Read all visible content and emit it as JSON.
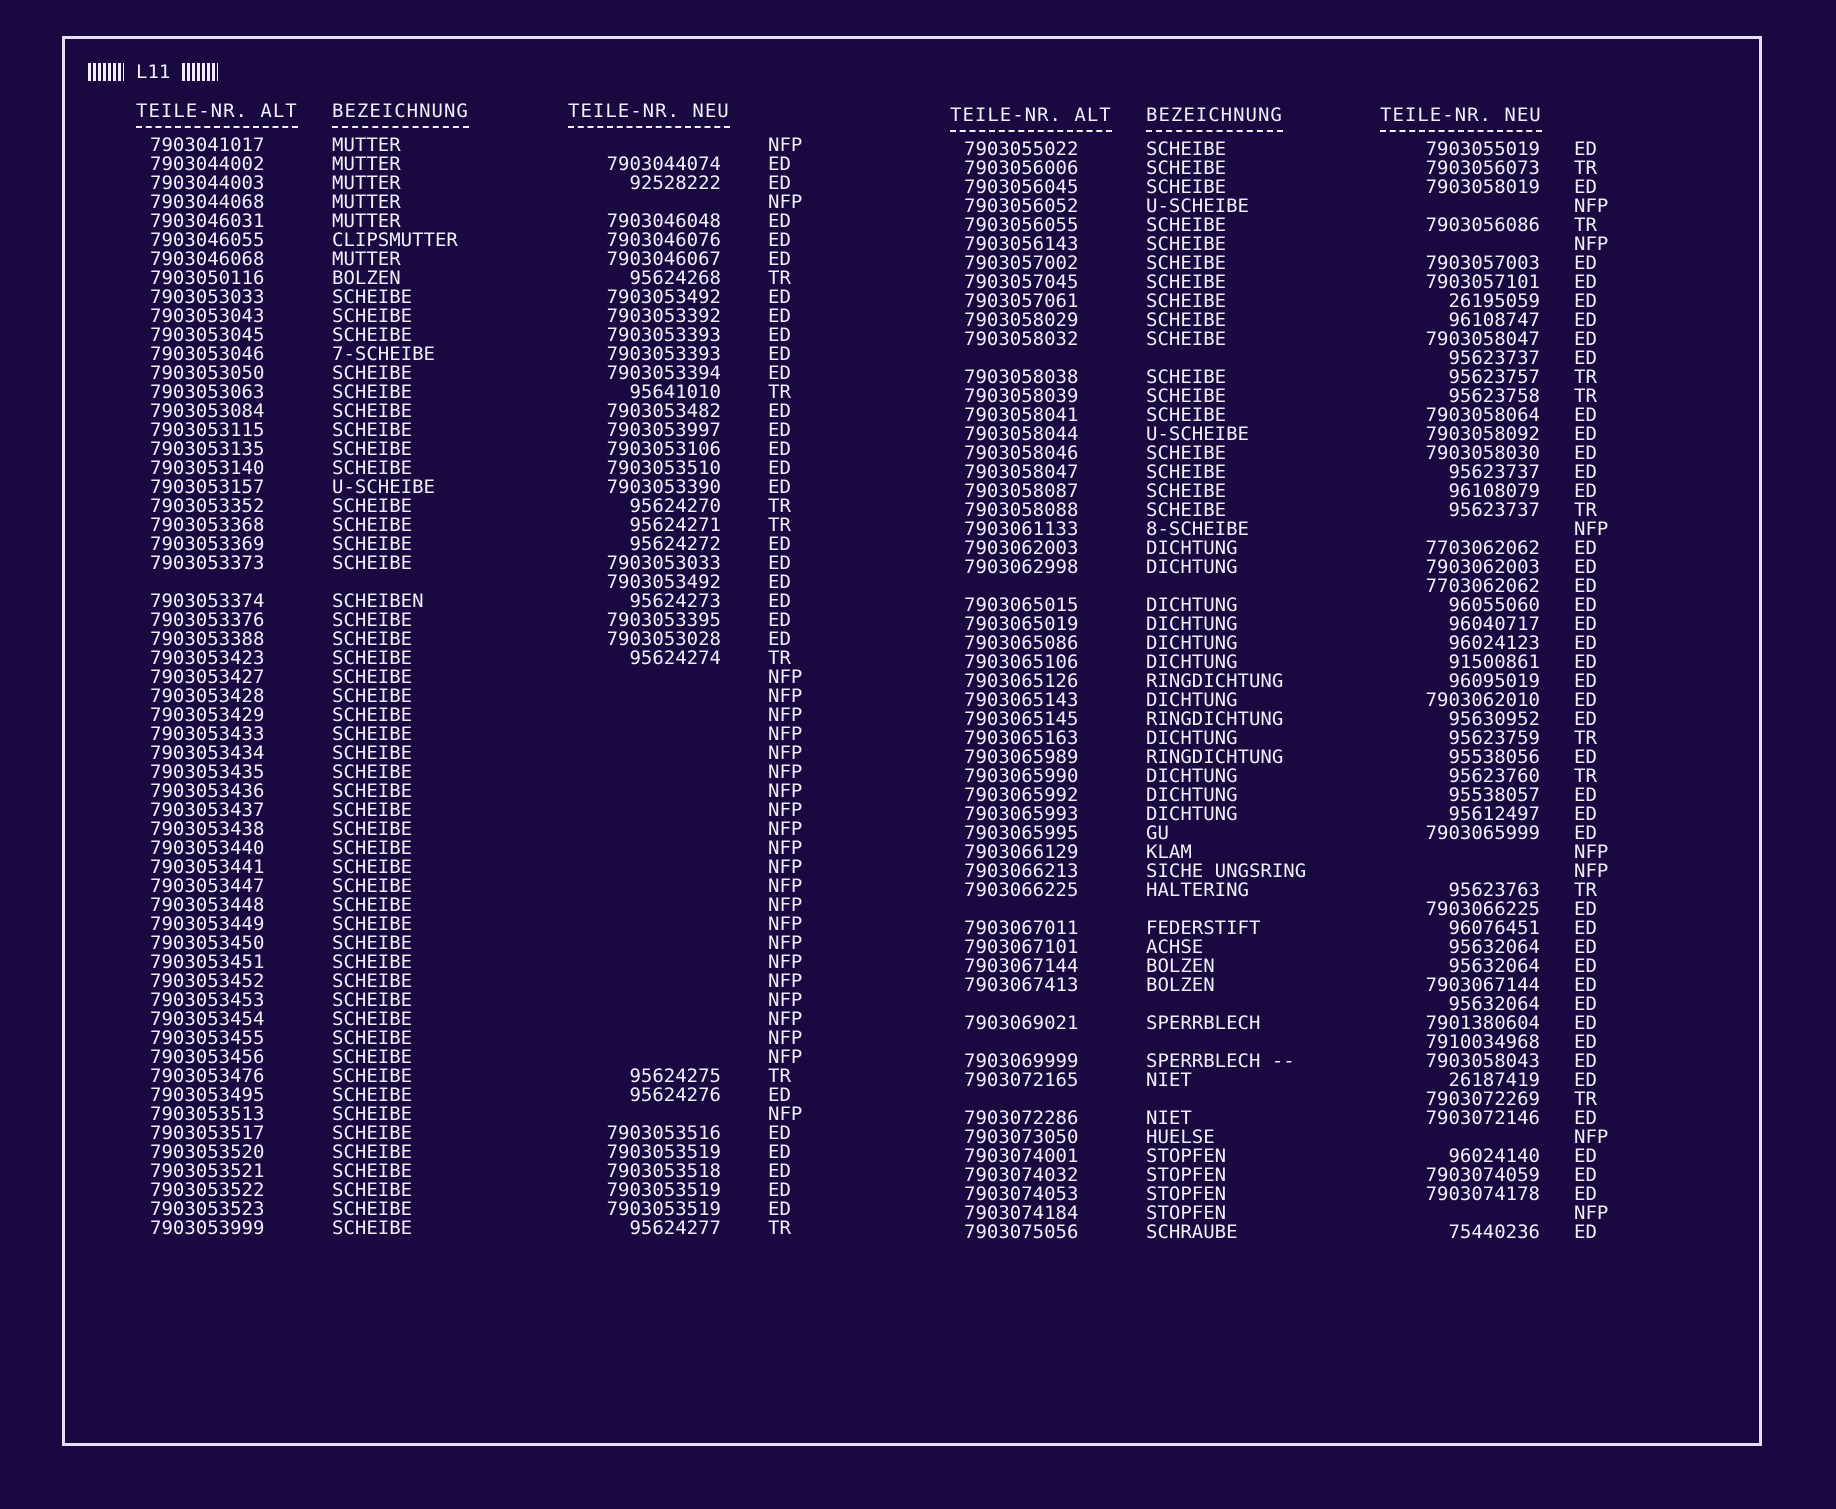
{
  "page_label": "L11",
  "headers": {
    "alt": "TEILE-NR. ALT",
    "bez": "BEZEICHNUNG",
    "neu": "TEILE-NR. NEU"
  },
  "left_rows": [
    {
      "alt": "7903041017",
      "bez": "MUTTER",
      "neu": "",
      "code": "NFP"
    },
    {
      "alt": "7903044002",
      "bez": "MUTTER",
      "neu": "7903044074",
      "code": "ED"
    },
    {
      "alt": "7903044003",
      "bez": "MUTTER",
      "neu": "92528222",
      "code": "ED"
    },
    {
      "alt": "7903044068",
      "bez": "MUTTER",
      "neu": "",
      "code": "NFP"
    },
    {
      "alt": "7903046031",
      "bez": "MUTTER",
      "neu": "7903046048",
      "code": "ED"
    },
    {
      "alt": "7903046055",
      "bez": "CLIPSMUTTER",
      "neu": "7903046076",
      "code": "ED"
    },
    {
      "alt": "7903046068",
      "bez": "MUTTER",
      "neu": "7903046067",
      "code": "ED"
    },
    {
      "alt": "7903050116",
      "bez": "BOLZEN",
      "neu": "95624268",
      "code": "TR"
    },
    {
      "alt": "7903053033",
      "bez": "SCHEIBE",
      "neu": "7903053492",
      "code": "ED"
    },
    {
      "alt": "7903053043",
      "bez": "SCHEIBE",
      "neu": "7903053392",
      "code": "ED"
    },
    {
      "alt": "7903053045",
      "bez": "SCHEIBE",
      "neu": "7903053393",
      "code": "ED"
    },
    {
      "alt": "7903053046",
      "bez": "7-SCHEIBE",
      "neu": "7903053393",
      "code": "ED"
    },
    {
      "alt": "7903053050",
      "bez": "SCHEIBE",
      "neu": "7903053394",
      "code": "ED"
    },
    {
      "alt": "7903053063",
      "bez": "SCHEIBE",
      "neu": "95641010",
      "code": "TR"
    },
    {
      "alt": "7903053084",
      "bez": "SCHEIBE",
      "neu": "7903053482",
      "code": "ED"
    },
    {
      "alt": "7903053115",
      "bez": "SCHEIBE",
      "neu": "7903053997",
      "code": "ED"
    },
    {
      "alt": "7903053135",
      "bez": "SCHEIBE",
      "neu": "7903053106",
      "code": "ED"
    },
    {
      "alt": "7903053140",
      "bez": "SCHEIBE",
      "neu": "7903053510",
      "code": "ED"
    },
    {
      "alt": "7903053157",
      "bez": "U-SCHEIBE",
      "neu": "7903053390",
      "code": "ED"
    },
    {
      "alt": "7903053352",
      "bez": "SCHEIBE",
      "neu": "95624270",
      "code": "TR"
    },
    {
      "alt": "7903053368",
      "bez": "SCHEIBE",
      "neu": "95624271",
      "code": "TR"
    },
    {
      "alt": "7903053369",
      "bez": "SCHEIBE",
      "neu": "95624272",
      "code": "ED"
    },
    {
      "alt": "7903053373",
      "bez": "SCHEIBE",
      "neu": "7903053033",
      "code": "ED"
    },
    {
      "alt": "",
      "bez": "",
      "neu": "7903053492",
      "code": "ED"
    },
    {
      "alt": "7903053374",
      "bez": "SCHEIBEN",
      "neu": "95624273",
      "code": "ED"
    },
    {
      "alt": "7903053376",
      "bez": "SCHEIBE",
      "neu": "7903053395",
      "code": "ED"
    },
    {
      "alt": "7903053388",
      "bez": "SCHEIBE",
      "neu": "7903053028",
      "code": "ED"
    },
    {
      "alt": "7903053423",
      "bez": "SCHEIBE",
      "neu": "95624274",
      "code": "TR"
    },
    {
      "alt": "7903053427",
      "bez": "SCHEIBE",
      "neu": "",
      "code": "NFP"
    },
    {
      "alt": "7903053428",
      "bez": "SCHEIBE",
      "neu": "",
      "code": "NFP"
    },
    {
      "alt": "7903053429",
      "bez": "SCHEIBE",
      "neu": "",
      "code": "NFP"
    },
    {
      "alt": "7903053433",
      "bez": "SCHEIBE",
      "neu": "",
      "code": "NFP"
    },
    {
      "alt": "7903053434",
      "bez": "SCHEIBE",
      "neu": "",
      "code": "NFP"
    },
    {
      "alt": "7903053435",
      "bez": "SCHEIBE",
      "neu": "",
      "code": "NFP"
    },
    {
      "alt": "7903053436",
      "bez": "SCHEIBE",
      "neu": "",
      "code": "NFP"
    },
    {
      "alt": "7903053437",
      "bez": "SCHEIBE",
      "neu": "",
      "code": "NFP"
    },
    {
      "alt": "7903053438",
      "bez": "SCHEIBE",
      "neu": "",
      "code": "NFP"
    },
    {
      "alt": "7903053440",
      "bez": "SCHEIBE",
      "neu": "",
      "code": "NFP"
    },
    {
      "alt": "7903053441",
      "bez": "SCHEIBE",
      "neu": "",
      "code": "NFP"
    },
    {
      "alt": "7903053447",
      "bez": "SCHEIBE",
      "neu": "",
      "code": "NFP"
    },
    {
      "alt": "7903053448",
      "bez": "SCHEIBE",
      "neu": "",
      "code": "NFP"
    },
    {
      "alt": "7903053449",
      "bez": "SCHEIBE",
      "neu": "",
      "code": "NFP"
    },
    {
      "alt": "7903053450",
      "bez": "SCHEIBE",
      "neu": "",
      "code": "NFP"
    },
    {
      "alt": "7903053451",
      "bez": "SCHEIBE",
      "neu": "",
      "code": "NFP"
    },
    {
      "alt": "7903053452",
      "bez": "SCHEIBE",
      "neu": "",
      "code": "NFP"
    },
    {
      "alt": "7903053453",
      "bez": "SCHEIBE",
      "neu": "",
      "code": "NFP"
    },
    {
      "alt": "7903053454",
      "bez": "SCHEIBE",
      "neu": "",
      "code": "NFP"
    },
    {
      "alt": "7903053455",
      "bez": "SCHEIBE",
      "neu": "",
      "code": "NFP"
    },
    {
      "alt": "7903053456",
      "bez": "SCHEIBE",
      "neu": "",
      "code": "NFP"
    },
    {
      "alt": "7903053476",
      "bez": "SCHEIBE",
      "neu": "95624275",
      "code": "TR"
    },
    {
      "alt": "7903053495",
      "bez": "SCHEIBE",
      "neu": "95624276",
      "code": "ED"
    },
    {
      "alt": "7903053513",
      "bez": "SCHEIBE",
      "neu": "",
      "code": "NFP"
    },
    {
      "alt": "7903053517",
      "bez": "SCHEIBE",
      "neu": "7903053516",
      "code": "ED"
    },
    {
      "alt": "7903053520",
      "bez": "SCHEIBE",
      "neu": "7903053519",
      "code": "ED"
    },
    {
      "alt": "7903053521",
      "bez": "SCHEIBE",
      "neu": "7903053518",
      "code": "ED"
    },
    {
      "alt": "7903053522",
      "bez": "SCHEIBE",
      "neu": "7903053519",
      "code": "ED"
    },
    {
      "alt": "7903053523",
      "bez": "SCHEIBE",
      "neu": "7903053519",
      "code": "ED"
    },
    {
      "alt": "7903053999",
      "bez": "SCHEIBE",
      "neu": "95624277",
      "code": "TR"
    }
  ],
  "right_rows": [
    {
      "alt": "7903055022",
      "bez": "SCHEIBE",
      "neu": "7903055019",
      "code": "ED"
    },
    {
      "alt": "7903056006",
      "bez": "SCHEIBE",
      "neu": "7903056073",
      "code": "TR"
    },
    {
      "alt": "7903056045",
      "bez": "SCHEIBE",
      "neu": "7903058019",
      "code": "ED"
    },
    {
      "alt": "7903056052",
      "bez": "U-SCHEIBE",
      "neu": "",
      "code": "NFP"
    },
    {
      "alt": "7903056055",
      "bez": "SCHEIBE",
      "neu": "7903056086",
      "code": "TR"
    },
    {
      "alt": "7903056143",
      "bez": "SCHEIBE",
      "neu": "",
      "code": "NFP"
    },
    {
      "alt": "7903057002",
      "bez": "SCHEIBE",
      "neu": "7903057003",
      "code": "ED"
    },
    {
      "alt": "7903057045",
      "bez": "SCHEIBE",
      "neu": "7903057101",
      "code": "ED"
    },
    {
      "alt": "7903057061",
      "bez": "SCHEIBE",
      "neu": "26195059",
      "code": "ED"
    },
    {
      "alt": "7903058029",
      "bez": "SCHEIBE",
      "neu": "96108747",
      "code": "ED"
    },
    {
      "alt": "7903058032",
      "bez": "SCHEIBE",
      "neu": "7903058047",
      "code": "ED"
    },
    {
      "alt": "",
      "bez": "",
      "neu": "95623737",
      "code": "ED"
    },
    {
      "alt": "7903058038",
      "bez": "SCHEIBE",
      "neu": "95623757",
      "code": "TR"
    },
    {
      "alt": "7903058039",
      "bez": "SCHEIBE",
      "neu": "95623758",
      "code": "TR"
    },
    {
      "alt": "7903058041",
      "bez": "SCHEIBE",
      "neu": "7903058064",
      "code": "ED"
    },
    {
      "alt": "7903058044",
      "bez": "U-SCHEIBE",
      "neu": "7903058092",
      "code": "ED"
    },
    {
      "alt": "7903058046",
      "bez": "SCHEIBE",
      "neu": "7903058030",
      "code": "ED"
    },
    {
      "alt": "7903058047",
      "bez": "SCHEIBE",
      "neu": "95623737",
      "code": "ED"
    },
    {
      "alt": "7903058087",
      "bez": "SCHEIBE",
      "neu": "96108079",
      "code": "ED"
    },
    {
      "alt": "7903058088",
      "bez": "SCHEIBE",
      "neu": "95623737",
      "code": "TR"
    },
    {
      "alt": "7903061133",
      "bez": "8-SCHEIBE",
      "neu": "",
      "code": "NFP"
    },
    {
      "alt": "7903062003",
      "bez": "DICHTUNG",
      "neu": "7703062062",
      "code": "ED"
    },
    {
      "alt": "7903062998",
      "bez": "DICHTUNG",
      "neu": "7903062003",
      "code": "ED"
    },
    {
      "alt": "",
      "bez": "",
      "neu": "7703062062",
      "code": "ED"
    },
    {
      "alt": "7903065015",
      "bez": "DICHTUNG",
      "neu": "96055060",
      "code": "ED"
    },
    {
      "alt": "7903065019",
      "bez": "DICHTUNG",
      "neu": "96040717",
      "code": "ED"
    },
    {
      "alt": "7903065086",
      "bez": "DICHTUNG",
      "neu": "96024123",
      "code": "ED"
    },
    {
      "alt": "7903065106",
      "bez": "DICHTUNG",
      "neu": "91500861",
      "code": "ED"
    },
    {
      "alt": "7903065126",
      "bez": "RINGDICHTUNG",
      "neu": "96095019",
      "code": "ED"
    },
    {
      "alt": "7903065143",
      "bez": "DICHTUNG",
      "neu": "7903062010",
      "code": "ED"
    },
    {
      "alt": "7903065145",
      "bez": "RINGDICHTUNG",
      "neu": "95630952",
      "code": "ED"
    },
    {
      "alt": "7903065163",
      "bez": "DICHTUNG",
      "neu": "95623759",
      "code": "TR"
    },
    {
      "alt": "7903065989",
      "bez": "RINGDICHTUNG",
      "neu": "95538056",
      "code": "ED"
    },
    {
      "alt": "7903065990",
      "bez": "DICHTUNG",
      "neu": "95623760",
      "code": "TR"
    },
    {
      "alt": "7903065992",
      "bez": "DICHTUNG",
      "neu": "95538057",
      "code": "ED"
    },
    {
      "alt": "7903065993",
      "bez": "DICHTUNG",
      "neu": "95612497",
      "code": "ED"
    },
    {
      "alt": "7903065995",
      "bez": "GU",
      "neu": "7903065999",
      "code": "ED"
    },
    {
      "alt": "7903066129",
      "bez": "KLAM",
      "neu": "",
      "code": "NFP"
    },
    {
      "alt": "7903066213",
      "bez": "SICHE UNGSRING",
      "neu": "",
      "code": "NFP"
    },
    {
      "alt": "7903066225",
      "bez": "HALTERING",
      "neu": "95623763",
      "code": "TR"
    },
    {
      "alt": "",
      "bez": "",
      "neu": "7903066225",
      "code": "ED"
    },
    {
      "alt": "7903067011",
      "bez": "FEDERSTIFT",
      "neu": "96076451",
      "code": "ED"
    },
    {
      "alt": "7903067101",
      "bez": "ACHSE",
      "neu": "95632064",
      "code": "ED"
    },
    {
      "alt": "7903067144",
      "bez": "BOLZEN",
      "neu": "95632064",
      "code": "ED"
    },
    {
      "alt": "7903067413",
      "bez": "BOLZEN",
      "neu": "7903067144",
      "code": "ED"
    },
    {
      "alt": "",
      "bez": "",
      "neu": "95632064",
      "code": "ED"
    },
    {
      "alt": "7903069021",
      "bez": "SPERRBLECH",
      "neu": "7901380604",
      "code": "ED"
    },
    {
      "alt": "",
      "bez": "",
      "neu": "7910034968",
      "code": "ED"
    },
    {
      "alt": "7903069999",
      "bez": "SPERRBLECH    --",
      "neu": "7903058043",
      "code": "ED"
    },
    {
      "alt": "7903072165",
      "bez": "NIET",
      "neu": "26187419",
      "code": "ED"
    },
    {
      "alt": "",
      "bez": "",
      "neu": "7903072269",
      "code": "TR"
    },
    {
      "alt": "7903072286",
      "bez": "NIET",
      "neu": "7903072146",
      "code": "ED"
    },
    {
      "alt": "7903073050",
      "bez": "HUELSE",
      "neu": "",
      "code": "NFP"
    },
    {
      "alt": "7903074001",
      "bez": "STOPFEN",
      "neu": "96024140",
      "code": "ED"
    },
    {
      "alt": "7903074032",
      "bez": "STOPFEN",
      "neu": "7903074059",
      "code": "ED"
    },
    {
      "alt": "7903074053",
      "bez": "STOPFEN",
      "neu": "7903074178",
      "code": "ED"
    },
    {
      "alt": "7903074184",
      "bez": "STOPFEN",
      "neu": "",
      "code": "NFP"
    },
    {
      "alt": "7903075056",
      "bez": "SCHRAUBE",
      "neu": "75440236",
      "code": "ED"
    }
  ]
}
